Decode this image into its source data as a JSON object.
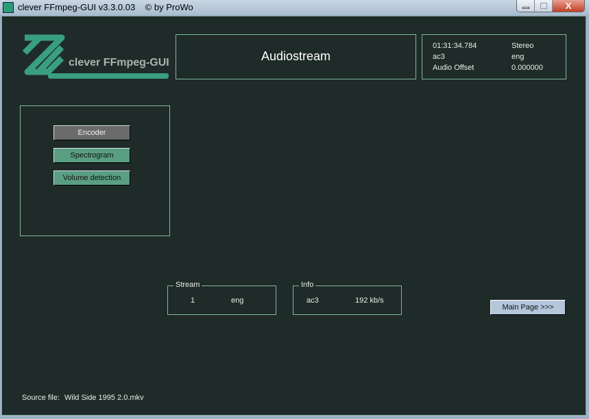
{
  "window": {
    "title": "clever FFmpeg-GUI v3.3.0.03    © by ProWo",
    "close_glyph": "X"
  },
  "logo": {
    "text": "clever FFmpeg-GUI"
  },
  "header": {
    "title": "Audiostream"
  },
  "info_panel": {
    "duration": "01:31:34.784",
    "channels": "Stereo",
    "codec": "ac3",
    "language": "eng",
    "offset_label": "Audio Offset",
    "offset_value": "0.000000"
  },
  "menu": {
    "encoder": "Encoder",
    "spectrogram": "Spectrogram",
    "volume_detection": "Volume detection"
  },
  "stream_group": {
    "label": "Stream",
    "index": "1",
    "language": "eng"
  },
  "info_group": {
    "label": "Info",
    "codec": "ac3",
    "bitrate": "192 kb/s"
  },
  "main_page_button": "Main Page >>>",
  "source": {
    "label": "Source file:",
    "value": "Wild Side 1995 2.0.mkv"
  },
  "colors": {
    "background": "#1f2b28",
    "accent": "#3a9e80",
    "border": "#7fb8a2"
  }
}
